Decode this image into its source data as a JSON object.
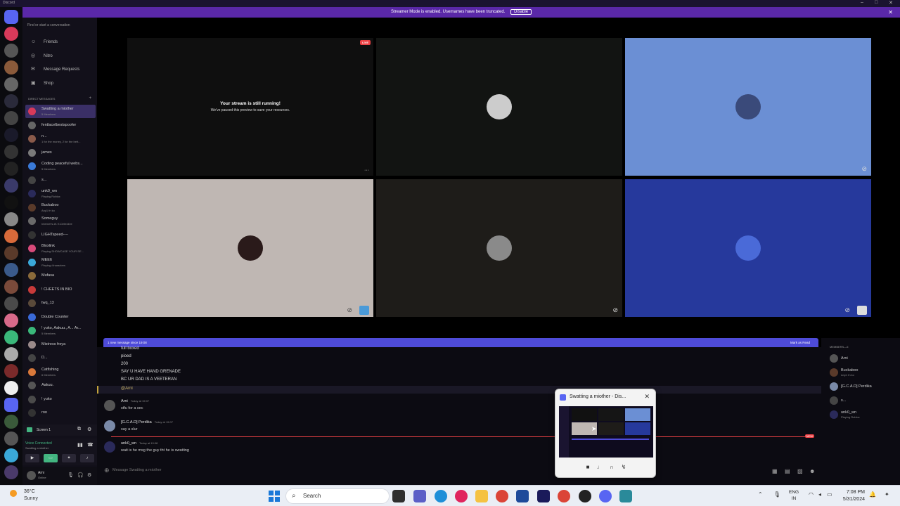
{
  "window": {
    "app_title": "Discord"
  },
  "streamer_banner": {
    "text": "Streamer Mode is enabled. Usernames have been truncated.",
    "disable_label": "Disable"
  },
  "sidebar": {
    "search_placeholder": "Find or start a conversation",
    "nav": [
      "Friends",
      "Nitro",
      "Message Requests",
      "Shop"
    ],
    "dm_header": "DIRECT MESSAGES",
    "dms": [
      {
        "name": "Swatting a miother",
        "sub": "5 Members",
        "color": "#d83a5a",
        "active": true
      },
      {
        "name": "fentlacelbestspoofer",
        "sub": "",
        "color": "#666666"
      },
      {
        "name": "n...",
        "sub": "1 for the money, 2 for the bett...",
        "color": "#8a5a4a"
      },
      {
        "name": "james",
        "sub": "",
        "color": "#7a7a7a"
      },
      {
        "name": "Coding peaceful webs...",
        "sub": "5 Members",
        "color": "#3a7ad8"
      },
      {
        "name": "s...",
        "sub": "",
        "color": "#444444"
      },
      {
        "name": "unk0_wn",
        "sub": "Playing Roblox",
        "color": "#2a2a5a"
      },
      {
        "name": "Buckaboo",
        "sub": "Any1 fn ko",
        "color": "#5a3a2a"
      },
      {
        "name": "Someguy",
        "sub": "Internet's #1 E-Detective",
        "color": "#6a6a6a"
      },
      {
        "name": "LIGHTspeed----",
        "sub": "",
        "color": "#333333"
      },
      {
        "name": "Bloxlink",
        "sub": "Playing SHOWCASE YOUR SE...",
        "color": "#d84a7a"
      },
      {
        "name": "MEE6",
        "sub": "Playing /characters",
        "color": "#3aa8d8"
      },
      {
        "name": "Mufasa",
        "sub": "",
        "color": "#8a6a3a"
      },
      {
        "name": "! CHEETS IN BIO",
        "sub": "",
        "color": "#c83a3a"
      },
      {
        "name": "twq_13",
        "sub": "",
        "color": "#5a4a3a"
      },
      {
        "name": "Double Counter",
        "sub": "",
        "color": "#3a6ad8"
      },
      {
        "name": "! yuko, Aakuu., A... Ar...",
        "sub": "5 Members",
        "color": "#3ab87a"
      },
      {
        "name": "Mistress freya",
        "sub": "",
        "color": "#9a8a8a"
      },
      {
        "name": "D...",
        "sub": "",
        "color": "#444444"
      },
      {
        "name": "Catfishing",
        "sub": "6 Members",
        "color": "#d8783a"
      },
      {
        "name": "Aakuu.",
        "sub": "",
        "color": "#555555"
      },
      {
        "name": "! yuko",
        "sub": "",
        "color": "#4a4a4a"
      },
      {
        "name": "roo",
        "sub": "",
        "color": "#333333"
      }
    ],
    "screen_label": "Screen 1",
    "voice_status": "Voice Connected",
    "voice_channel": "Swatting a miother",
    "user_name": "Arni",
    "user_status": "Online"
  },
  "stage": {
    "live_badge": "LIVE",
    "paused_title": "Your stream is still running!",
    "paused_sub": "We've paused this preview to save your resources.",
    "more": "···",
    "tiles": [
      {
        "bg": "#0f0f0f",
        "avatar": null
      },
      {
        "bg": "#121412",
        "avatar": "#cccccc"
      },
      {
        "bg": "#6b8fd4",
        "avatar": "#3a4a7a"
      },
      {
        "bg": "#bfb7b3",
        "avatar": "#2a1a1a"
      },
      {
        "bg": "#1e1c19",
        "avatar": "#8a8a8a"
      },
      {
        "bg": "#26399c",
        "avatar": "#4a6ad8"
      }
    ]
  },
  "chat": {
    "new_bar": "1 new message since 19:08",
    "mark_read": "Mark as Read",
    "lines": [
      "full boxed",
      "pioed",
      "200",
      "SAY U HAVE HAND GRENADE",
      "BC UR DAD IS A VEETERAN",
      "@Arni"
    ],
    "messages": [
      {
        "name": "Arni",
        "time": "Today at 19:07",
        "text": "stfu for a sec",
        "color": "#555555"
      },
      {
        "name": "[G.C.A.D] Perdika",
        "time": "Today at 19:07",
        "text": "say a slur",
        "color": "#7a8aa8"
      },
      {
        "name": "unk0_wn",
        "time": "Today at 19:08",
        "text": "wait is he msg the guy tht he is swatting",
        "color": "#2a2a5a"
      }
    ],
    "new_label": "NEW",
    "composer_placeholder": "Message Swatting a miother"
  },
  "members": {
    "header": "MEMBERS—5",
    "list": [
      {
        "name": "Arni",
        "sub": "",
        "color": "#555555"
      },
      {
        "name": "Buckaboo",
        "sub": "Any1 fn ko",
        "color": "#5a3a2a"
      },
      {
        "name": "[G.C.A.D] Perdika",
        "sub": "",
        "color": "#7a8aa8"
      },
      {
        "name": "s...",
        "sub": "",
        "color": "#444444"
      },
      {
        "name": "unk0_wn",
        "sub": "Playing Roblox",
        "color": "#2a2a5a"
      }
    ]
  },
  "popup": {
    "title": "Swatting a miother - Dis..."
  },
  "taskbar": {
    "temp": "36°C",
    "weather": "Sunny",
    "search": "Search",
    "lang1": "ENG",
    "lang2": "IN",
    "time": "7:08 PM",
    "date": "5/31/2024"
  },
  "colors": {
    "accent": "#5865f2",
    "streamer": "#5a28a8",
    "new_bar": "#4e4bd8",
    "live": "#ed4245"
  }
}
